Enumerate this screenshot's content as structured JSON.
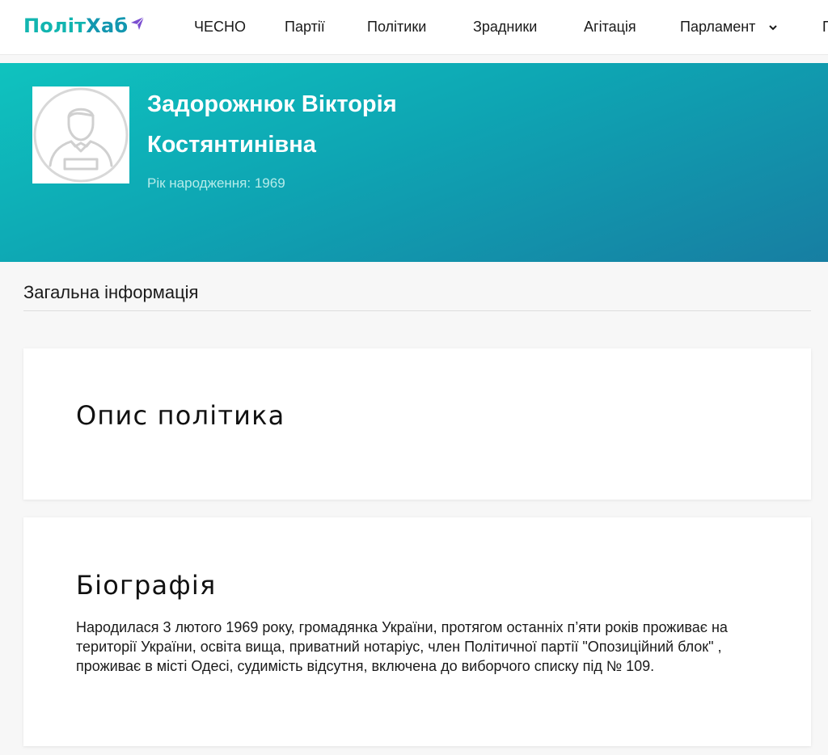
{
  "brand": {
    "part1": "Політ",
    "part2": "Хаб"
  },
  "nav": {
    "items": [
      {
        "label": "ЧЕСНО"
      },
      {
        "label": "Партії"
      },
      {
        "label": "Політики"
      },
      {
        "label": "Зрадники"
      },
      {
        "label": "Агітація"
      },
      {
        "label": "Парламент"
      },
      {
        "label": "П"
      }
    ]
  },
  "profile": {
    "name_line1": "Задорожнюк Вікторія",
    "name_line2": "Костянтинівна",
    "birth": "Рік народження: 1969"
  },
  "section": {
    "title": "Загальна інформація"
  },
  "cards": {
    "description_title": "Опис політика",
    "bio_title": "Біографія",
    "bio_text": "Народилася 3 лютого 1969 року, громадянка України, протягом останніх п’яти років проживає на території України, освіта вища, приватний нотаріус, член Політичної партії \"Опозиційний блок\" , проживає в місті Одесі, судимість відсутня, включена до виборчого списку під № 109."
  },
  "icons": {
    "logo_arrow": "send-arrow-icon",
    "dropdown": "chevron-down-icon",
    "avatar": "user-placeholder-icon"
  },
  "colors": {
    "brand_teal": "#12b5b0",
    "brand_purple": "#7b4fd0",
    "hero_start": "#0fc3bf",
    "hero_end": "#177ea2"
  }
}
